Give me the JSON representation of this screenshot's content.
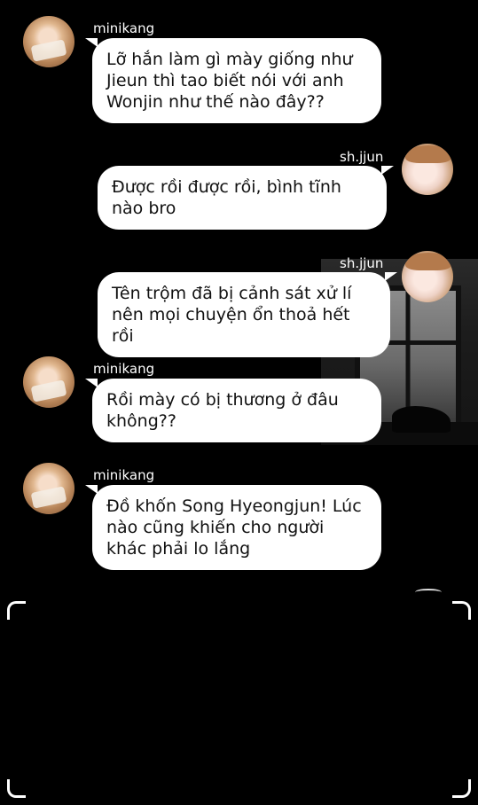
{
  "messages": [
    {
      "sender": "minikang",
      "side": "left",
      "text": "Lỡ hắn làm gì mày giống như Jieun thì tao biết nói với anh Wonjin như thế nào đây??"
    },
    {
      "sender": "sh.jjun",
      "side": "right",
      "text": "Được rồi được rồi, bình tĩnh nào bro"
    },
    {
      "sender": "sh.jjun",
      "side": "right",
      "text": "Tên trộm đã bị cảnh sát xử lí nên mọi chuyện ổn thoả hết rồi"
    },
    {
      "sender": "minikang",
      "side": "left",
      "text": "Rồi mày có bị thương ở đâu không??"
    },
    {
      "sender": "minikang",
      "side": "left",
      "text": "Đồ khốn Song Hyeongjun! Lúc nào cũng khiến cho người khác phải lo lắng"
    }
  ],
  "colors": {
    "background": "#000000",
    "bubble": "#ffffff",
    "bubble_text": "#111111",
    "name_text": "#ffffff"
  },
  "icons": {
    "left_avatar": "minikang-avatar-photo",
    "right_avatar": "shjjun-avatar-photo"
  }
}
